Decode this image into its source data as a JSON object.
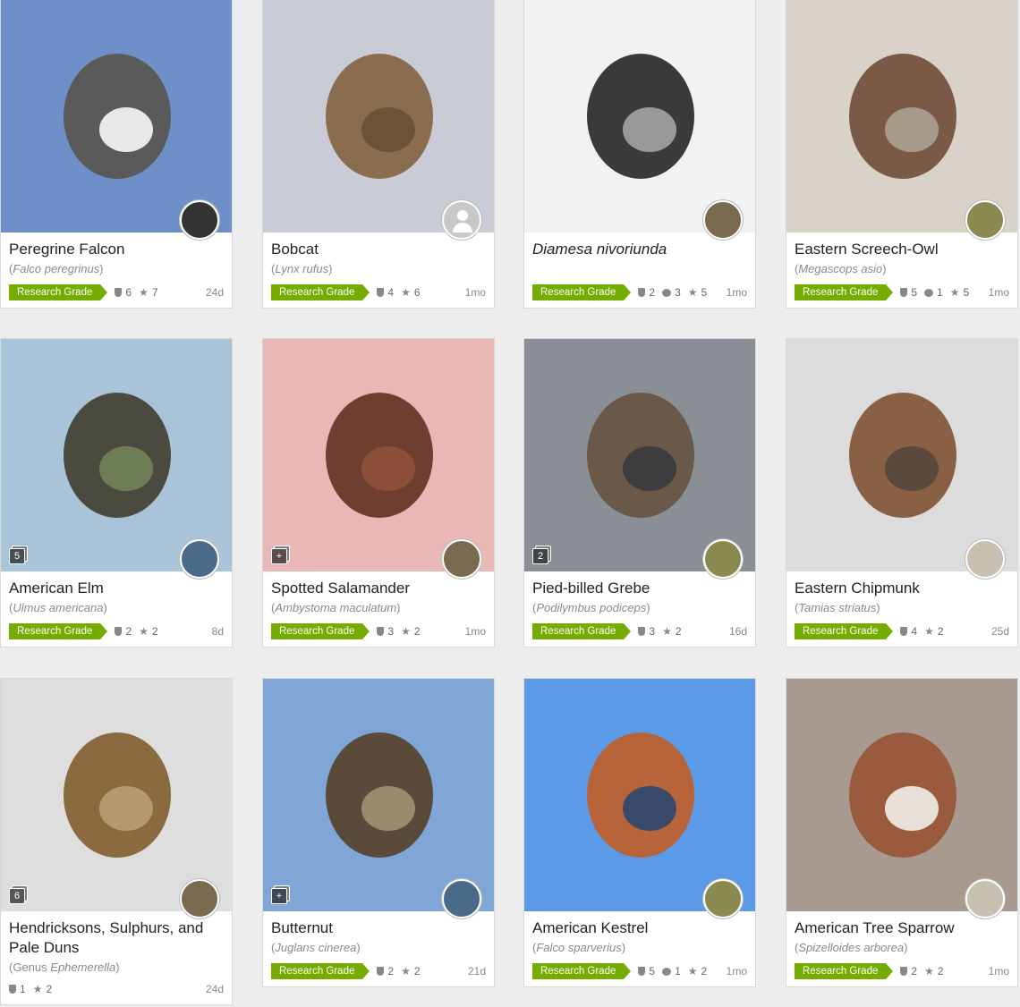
{
  "observations": [
    {
      "common_name": "Peregrine Falcon",
      "sci_prefix": "",
      "sci_name": "Falco peregrinus",
      "quality": "Research Grade",
      "ids": "6",
      "comments": "",
      "faves": "7",
      "age": "24d",
      "photo_count": "",
      "avatar": "photo",
      "colors": {
        "bg": "#6e8fc7",
        "a": "#5a5a5a",
        "b": "#e8e8e8",
        "av": "#333333"
      }
    },
    {
      "common_name": "Bobcat",
      "sci_prefix": "",
      "sci_name": "Lynx rufus",
      "quality": "Research Grade",
      "ids": "4",
      "comments": "",
      "faves": "6",
      "age": "1mo",
      "photo_count": "",
      "avatar": "default",
      "colors": {
        "bg": "#c9ccd6",
        "a": "#8a6d4e",
        "b": "#6b5238",
        "av": "#c8c8c8"
      }
    },
    {
      "common_name": "Diamesa nivoriunda",
      "sci_prefix": "",
      "sci_name": "",
      "quality": "Research Grade",
      "ids": "2",
      "comments": "3",
      "faves": "5",
      "age": "1mo",
      "photo_count": "",
      "avatar": "photo",
      "colors": {
        "bg": "#f2f2f2",
        "a": "#3a3a3a",
        "b": "#999999",
        "av": "#7a6a50"
      }
    },
    {
      "common_name": "Eastern Screech-Owl",
      "sci_prefix": "",
      "sci_name": "Megascops asio",
      "quality": "Research Grade",
      "ids": "5",
      "comments": "1",
      "faves": "5",
      "age": "1mo",
      "photo_count": "",
      "avatar": "photo",
      "colors": {
        "bg": "#d8d2c8",
        "a": "#7a5a46",
        "b": "#a89a88",
        "av": "#8a8a50"
      }
    },
    {
      "common_name": "American Elm",
      "sci_prefix": "",
      "sci_name": "Ulmus americana",
      "quality": "Research Grade",
      "ids": "2",
      "comments": "",
      "faves": "2",
      "age": "8d",
      "photo_count": "5",
      "avatar": "photo",
      "colors": {
        "bg": "#a9c3d8",
        "a": "#4a4a3e",
        "b": "#6f7d56",
        "av": "#4a6a8a"
      }
    },
    {
      "common_name": "Spotted Salamander",
      "sci_prefix": "",
      "sci_name": "Ambystoma maculatum",
      "quality": "Research Grade",
      "ids": "3",
      "comments": "",
      "faves": "2",
      "age": "1mo",
      "photo_count": "+",
      "avatar": "photo",
      "colors": {
        "bg": "#e8b7b6",
        "a": "#6e3e2e",
        "b": "#8b4f3a",
        "av": "#7a6a50"
      }
    },
    {
      "common_name": "Pied-billed Grebe",
      "sci_prefix": "",
      "sci_name": "Podilymbus podiceps",
      "quality": "Research Grade",
      "ids": "3",
      "comments": "",
      "faves": "2",
      "age": "16d",
      "photo_count": "2",
      "avatar": "photo",
      "colors": {
        "bg": "#8a8f96",
        "a": "#6a5848",
        "b": "#3e3e40",
        "av": "#8a8a50"
      }
    },
    {
      "common_name": "Eastern Chipmunk",
      "sci_prefix": "",
      "sci_name": "Tamias striatus",
      "quality": "Research Grade",
      "ids": "4",
      "comments": "",
      "faves": "2",
      "age": "25d",
      "photo_count": "",
      "avatar": "photo",
      "colors": {
        "bg": "#dcdcdc",
        "a": "#8a6044",
        "b": "#5a4a3e",
        "av": "#c8c0b0"
      }
    },
    {
      "common_name": "Hendricksons, Sulphurs, and Pale Duns",
      "sci_prefix": "Genus",
      "sci_name": "Ephemerella",
      "quality": "",
      "ids": "1",
      "comments": "",
      "faves": "2",
      "age": "24d",
      "photo_count": "6",
      "avatar": "photo",
      "colors": {
        "bg": "#dedede",
        "a": "#8a6a3e",
        "b": "#b49a6e",
        "av": "#7a6a50"
      }
    },
    {
      "common_name": "Butternut",
      "sci_prefix": "",
      "sci_name": "Juglans cinerea",
      "quality": "Research Grade",
      "ids": "2",
      "comments": "",
      "faves": "2",
      "age": "21d",
      "photo_count": "+",
      "avatar": "photo",
      "colors": {
        "bg": "#7fa6d6",
        "a": "#5a4a3a",
        "b": "#9a8a6e",
        "av": "#4a6a8a"
      }
    },
    {
      "common_name": "American Kestrel",
      "sci_prefix": "",
      "sci_name": "Falco sparverius",
      "quality": "Research Grade",
      "ids": "5",
      "comments": "1",
      "faves": "2",
      "age": "1mo",
      "photo_count": "",
      "avatar": "photo",
      "colors": {
        "bg": "#5a9ae6",
        "a": "#b8643a",
        "b": "#3a4a6a",
        "av": "#8a8a50"
      }
    },
    {
      "common_name": "American Tree Sparrow",
      "sci_prefix": "",
      "sci_name": "Spizelloides arborea",
      "quality": "Research Grade",
      "ids": "2",
      "comments": "",
      "faves": "2",
      "age": "1mo",
      "photo_count": "",
      "avatar": "photo",
      "colors": {
        "bg": "#a89a8e",
        "a": "#9a5a3e",
        "b": "#e8e0d8",
        "av": "#c8c0b0"
      }
    }
  ]
}
